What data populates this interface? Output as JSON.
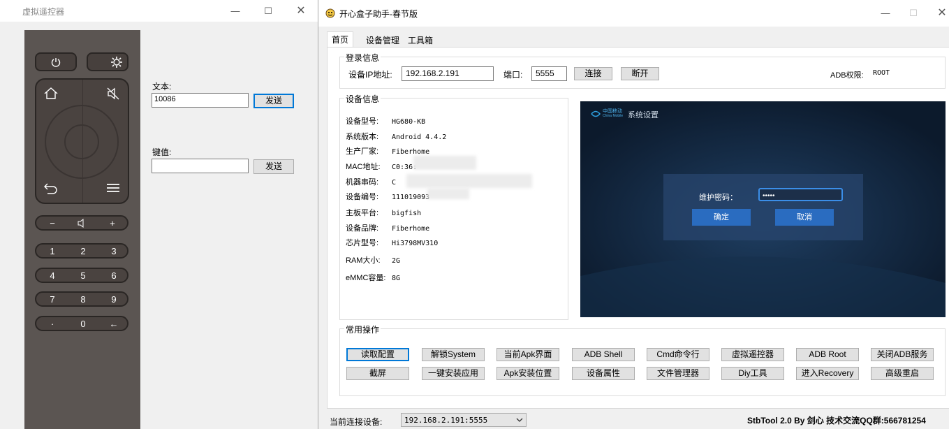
{
  "remote": {
    "title": "虚拟遥控器",
    "buttons": [
      "power-icon",
      "gear-icon",
      "home-icon",
      "mute-icon",
      "back-icon",
      "menu-icon"
    ],
    "vol_minus": "−",
    "vol_plus": "+",
    "num_rows": [
      [
        "1",
        "2",
        "3"
      ],
      [
        "4",
        "5",
        "6"
      ],
      [
        "7",
        "8",
        "9"
      ],
      [
        "·",
        "0",
        "←"
      ]
    ],
    "text_label": "文本:",
    "text_value": "10086",
    "text_send": "发送",
    "key_label": "键值:",
    "key_value": "",
    "key_send": "发送"
  },
  "main": {
    "title": "开心盒子助手-春节版",
    "tabs": [
      "首页",
      "设备管理",
      "工具箱"
    ],
    "login": {
      "group_title": "登录信息",
      "ip_label": "设备IP地址:",
      "ip_value": "192.168.2.191",
      "port_label": "端口:",
      "port_value": "5555",
      "connect": "连接",
      "disconnect": "断开",
      "adb_label": "ADB权限:",
      "adb_value": "ROOT"
    },
    "device": {
      "group_title": "设备信息",
      "rows": [
        {
          "k": "设备型号:",
          "v": "HG680-KB"
        },
        {
          "k": "系统版本:",
          "v": "Android 4.4.2"
        },
        {
          "k": "生产厂家:",
          "v": "Fiberhome"
        },
        {
          "k": "MAC地址:",
          "v": "C0:36:"
        },
        {
          "k": "机器串码:",
          "v": "C"
        },
        {
          "k": "设备编号:",
          "v": "111019093"
        },
        {
          "k": "主板平台:",
          "v": "bigfish"
        },
        {
          "k": "设备品牌:",
          "v": "Fiberhome"
        },
        {
          "k": "芯片型号:",
          "v": "Hi3798MV310"
        },
        {
          "k": "RAM大小:",
          "v": "2G"
        },
        {
          "k": "eMMC容量:",
          "v": "8G"
        }
      ]
    },
    "screen": {
      "brand": "中国移动",
      "brand_sub": "China Mobile",
      "title": "系统设置",
      "pwd_label": "维护密码：",
      "pwd_value": "•••••",
      "ok": "确定",
      "cancel": "取消"
    },
    "ops": {
      "group_title": "常用操作",
      "row1": [
        "读取配置",
        "解锁System",
        "当前Apk界面",
        "ADB Shell",
        "Cmd命令行",
        "虚拟遥控器",
        "ADB  Root",
        "关闭ADB服务"
      ],
      "row2": [
        "截屏",
        "一键安装应用",
        "Apk安装位置",
        "设备属性",
        "文件管理器",
        "Diy工具",
        "进入Recovery",
        "高级重启"
      ]
    },
    "status": {
      "label": "当前连接设备:",
      "device": "192.168.2.191:5555",
      "credit": "StbTool 2.0 By 剑心  技术交流QQ群:566781254"
    },
    "colors": {
      "accent": "#0078d7",
      "screen_bg": "#0f2137",
      "dialog_btn": "#2a6cc0"
    }
  }
}
